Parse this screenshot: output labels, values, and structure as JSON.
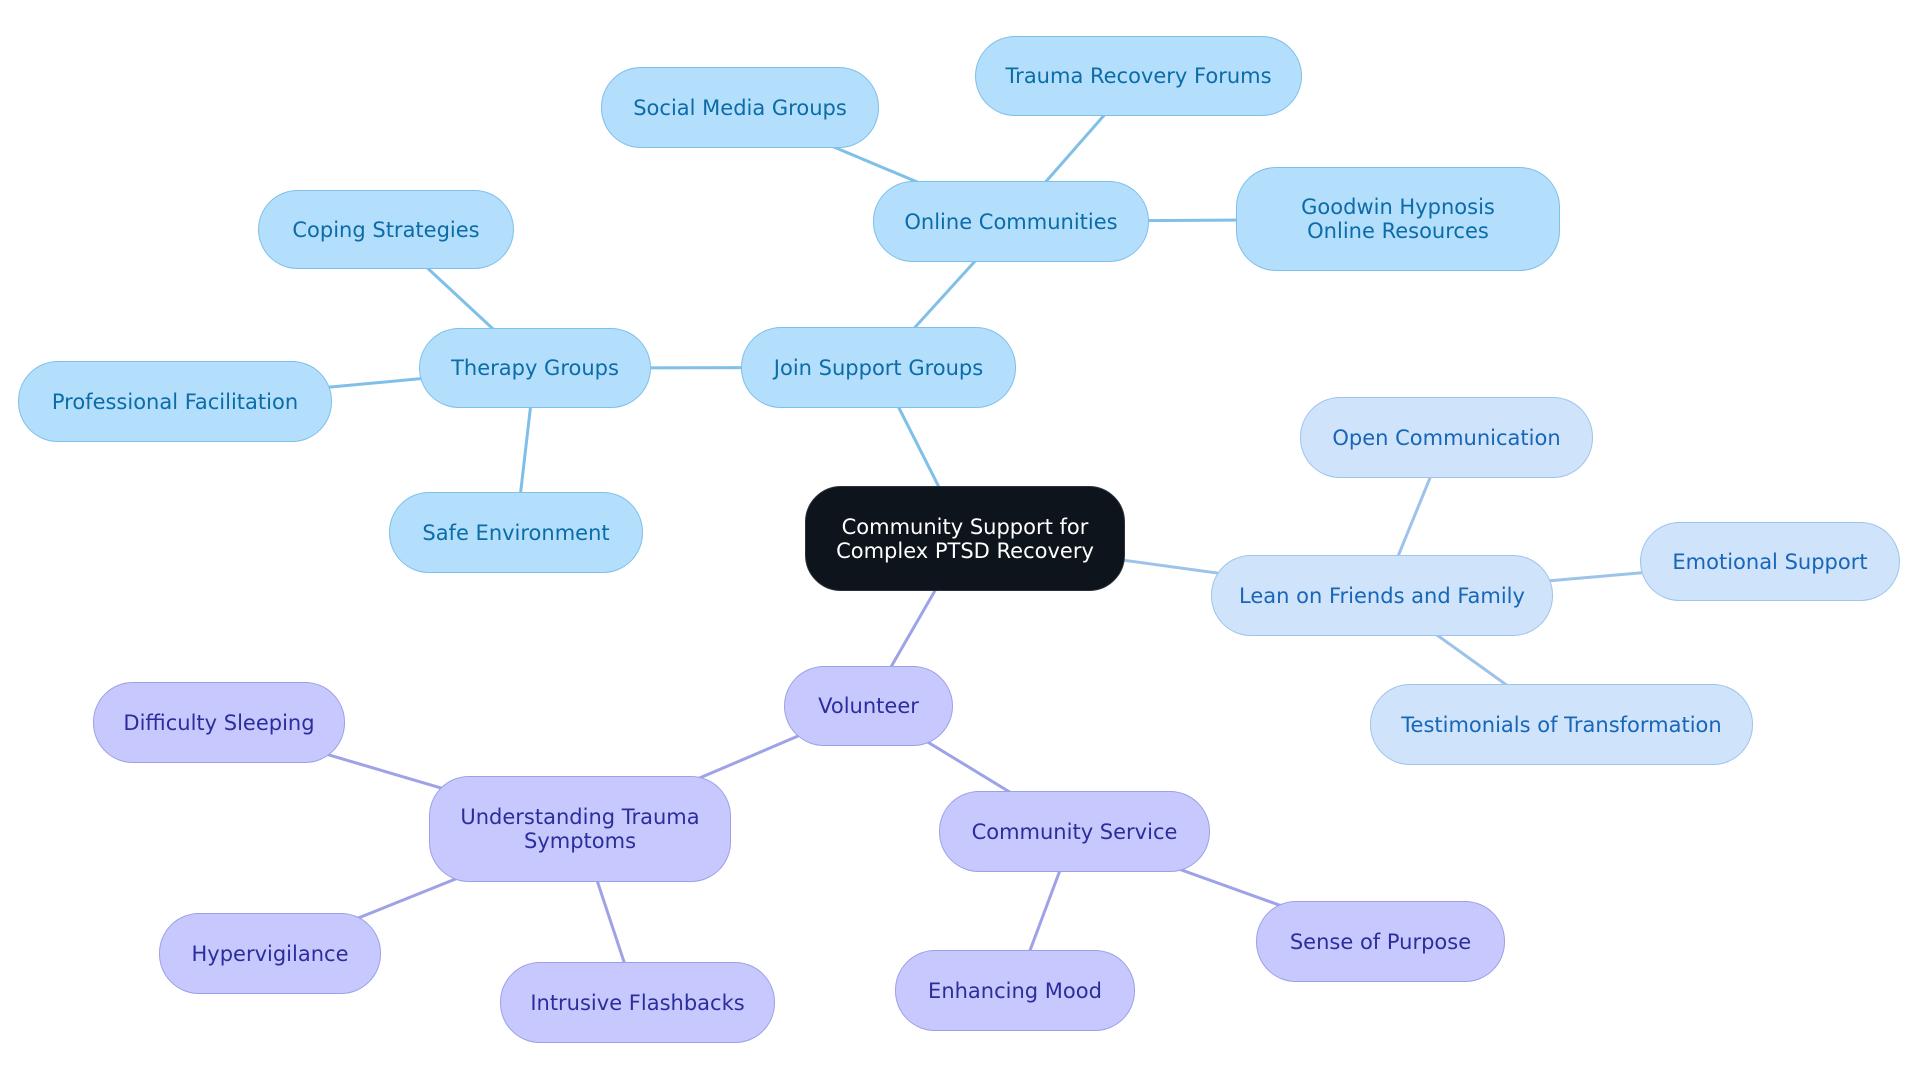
{
  "diagram": {
    "type": "mindmap",
    "colors": {
      "root_fill": "#0e141b",
      "branch_blue_fill": "#b3defc",
      "branch_blue_text": "#0b6ca8",
      "branch_blue_line": "#7fbfe8",
      "branch_grayblue_fill": "#cfe3fb",
      "branch_grayblue_text": "#1766b8",
      "branch_grayblue_line": "#9dc3ea",
      "branch_lavender_fill": "#c7c9fe",
      "branch_lavender_text": "#2c2d9c",
      "branch_lavender_line": "#9ea2e6"
    },
    "nodes": {
      "root": "Community Support for Complex PTSD Recovery",
      "join": "Join Support Groups",
      "online": "Online Communities",
      "social": "Social Media Groups",
      "forums": "Trauma Recovery Forums",
      "goodwin": "Goodwin Hypnosis Online Resources",
      "therapy": "Therapy Groups",
      "coping": "Coping Strategies",
      "prof": "Professional Facilitation",
      "safe": "Safe Environment",
      "lean": "Lean on Friends and Family",
      "open": "Open Communication",
      "emotional": "Emotional Support",
      "testimonials": "Testimonials of Transformation",
      "volunteer": "Volunteer",
      "understanding": "Understanding Trauma Symptoms",
      "sleeping": "Difficulty Sleeping",
      "hyper": "Hypervigilance",
      "flash": "Intrusive Flashbacks",
      "service": "Community Service",
      "mood": "Enhancing Mood",
      "purpose": "Sense of Purpose"
    },
    "edges": [
      {
        "from": "root",
        "to": "join",
        "branch": "blue"
      },
      {
        "from": "join",
        "to": "online",
        "branch": "blue"
      },
      {
        "from": "online",
        "to": "social",
        "branch": "blue"
      },
      {
        "from": "online",
        "to": "forums",
        "branch": "blue"
      },
      {
        "from": "online",
        "to": "goodwin",
        "branch": "blue"
      },
      {
        "from": "join",
        "to": "therapy",
        "branch": "blue"
      },
      {
        "from": "therapy",
        "to": "coping",
        "branch": "blue"
      },
      {
        "from": "therapy",
        "to": "prof",
        "branch": "blue"
      },
      {
        "from": "therapy",
        "to": "safe",
        "branch": "blue"
      },
      {
        "from": "root",
        "to": "lean",
        "branch": "grayblue"
      },
      {
        "from": "lean",
        "to": "open",
        "branch": "grayblue"
      },
      {
        "from": "lean",
        "to": "emotional",
        "branch": "grayblue"
      },
      {
        "from": "lean",
        "to": "testimonials",
        "branch": "grayblue"
      },
      {
        "from": "root",
        "to": "volunteer",
        "branch": "lavender"
      },
      {
        "from": "volunteer",
        "to": "understanding",
        "branch": "lavender"
      },
      {
        "from": "understanding",
        "to": "sleeping",
        "branch": "lavender"
      },
      {
        "from": "understanding",
        "to": "hyper",
        "branch": "lavender"
      },
      {
        "from": "understanding",
        "to": "flash",
        "branch": "lavender"
      },
      {
        "from": "volunteer",
        "to": "service",
        "branch": "lavender"
      },
      {
        "from": "service",
        "to": "mood",
        "branch": "lavender"
      },
      {
        "from": "service",
        "to": "purpose",
        "branch": "lavender"
      }
    ]
  }
}
